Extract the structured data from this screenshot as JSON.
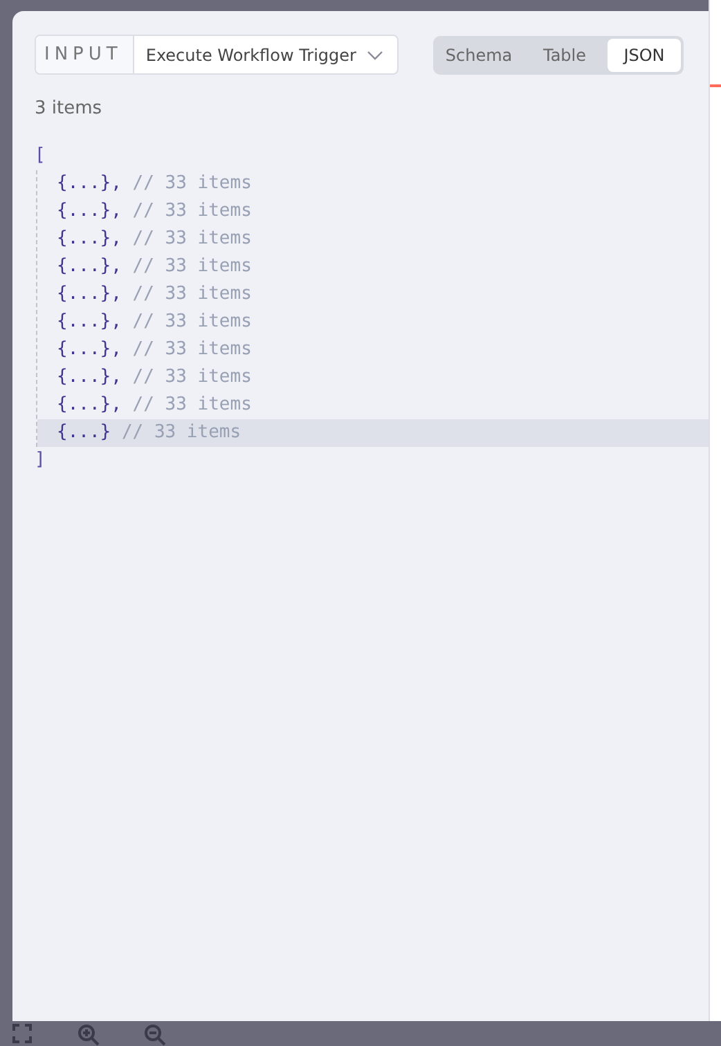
{
  "input_selector": {
    "label": "INPUT",
    "value": "Execute Workflow Trigger"
  },
  "view_tabs": [
    {
      "label": "Schema",
      "selected": false
    },
    {
      "label": "Table",
      "selected": false
    },
    {
      "label": "JSON",
      "selected": true
    }
  ],
  "item_count": "3 items",
  "json_view": {
    "open_bracket": "[",
    "close_bracket": "]",
    "rows": [
      {
        "value": "{...},",
        "comment": "// 33 items",
        "selected": false
      },
      {
        "value": "{...},",
        "comment": "// 33 items",
        "selected": false
      },
      {
        "value": "{...},",
        "comment": "// 33 items",
        "selected": false
      },
      {
        "value": "{...},",
        "comment": "// 33 items",
        "selected": false
      },
      {
        "value": "{...},",
        "comment": "// 33 items",
        "selected": false
      },
      {
        "value": "{...},",
        "comment": "// 33 items",
        "selected": false
      },
      {
        "value": "{...},",
        "comment": "// 33 items",
        "selected": false
      },
      {
        "value": "{...},",
        "comment": "// 33 items",
        "selected": false
      },
      {
        "value": "{...},",
        "comment": "// 33 items",
        "selected": false
      },
      {
        "value": "{...}",
        "comment": "// 33 items",
        "selected": true
      }
    ]
  }
}
